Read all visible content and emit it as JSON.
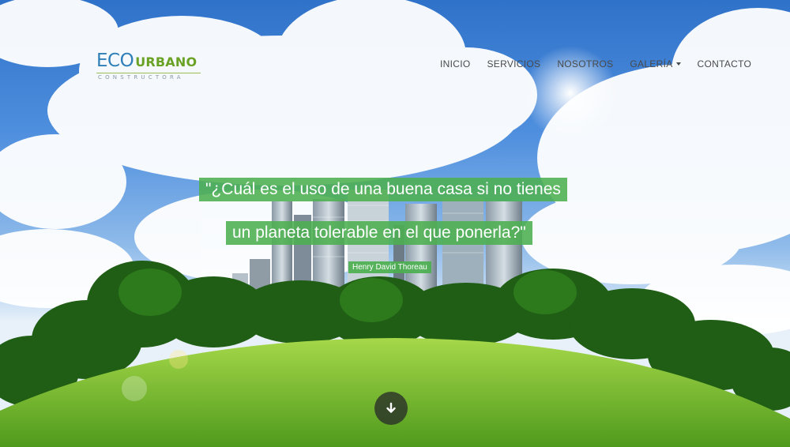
{
  "brand": {
    "name_eco": "ECO",
    "name_urbano": "URBANO",
    "tagline": "CONSTRUCTORA"
  },
  "nav": {
    "items": [
      {
        "label": "INICIO"
      },
      {
        "label": "SERVICIOS"
      },
      {
        "label": "NOSOTROS"
      },
      {
        "label": "GALERÍA"
      },
      {
        "label": "CONTACTO"
      }
    ]
  },
  "hero": {
    "quote_line1": "\"¿Cuál es el uso de una buena casa si no tienes",
    "quote_line2": "un planeta tolerable en el que ponerla?\"",
    "author": "Henry David Thoreau",
    "scroll_icon": "arrow-down-icon"
  },
  "colors": {
    "accent_green": "#4caf50",
    "brand_blue": "#2e7fb7",
    "brand_green": "#6aa225"
  }
}
